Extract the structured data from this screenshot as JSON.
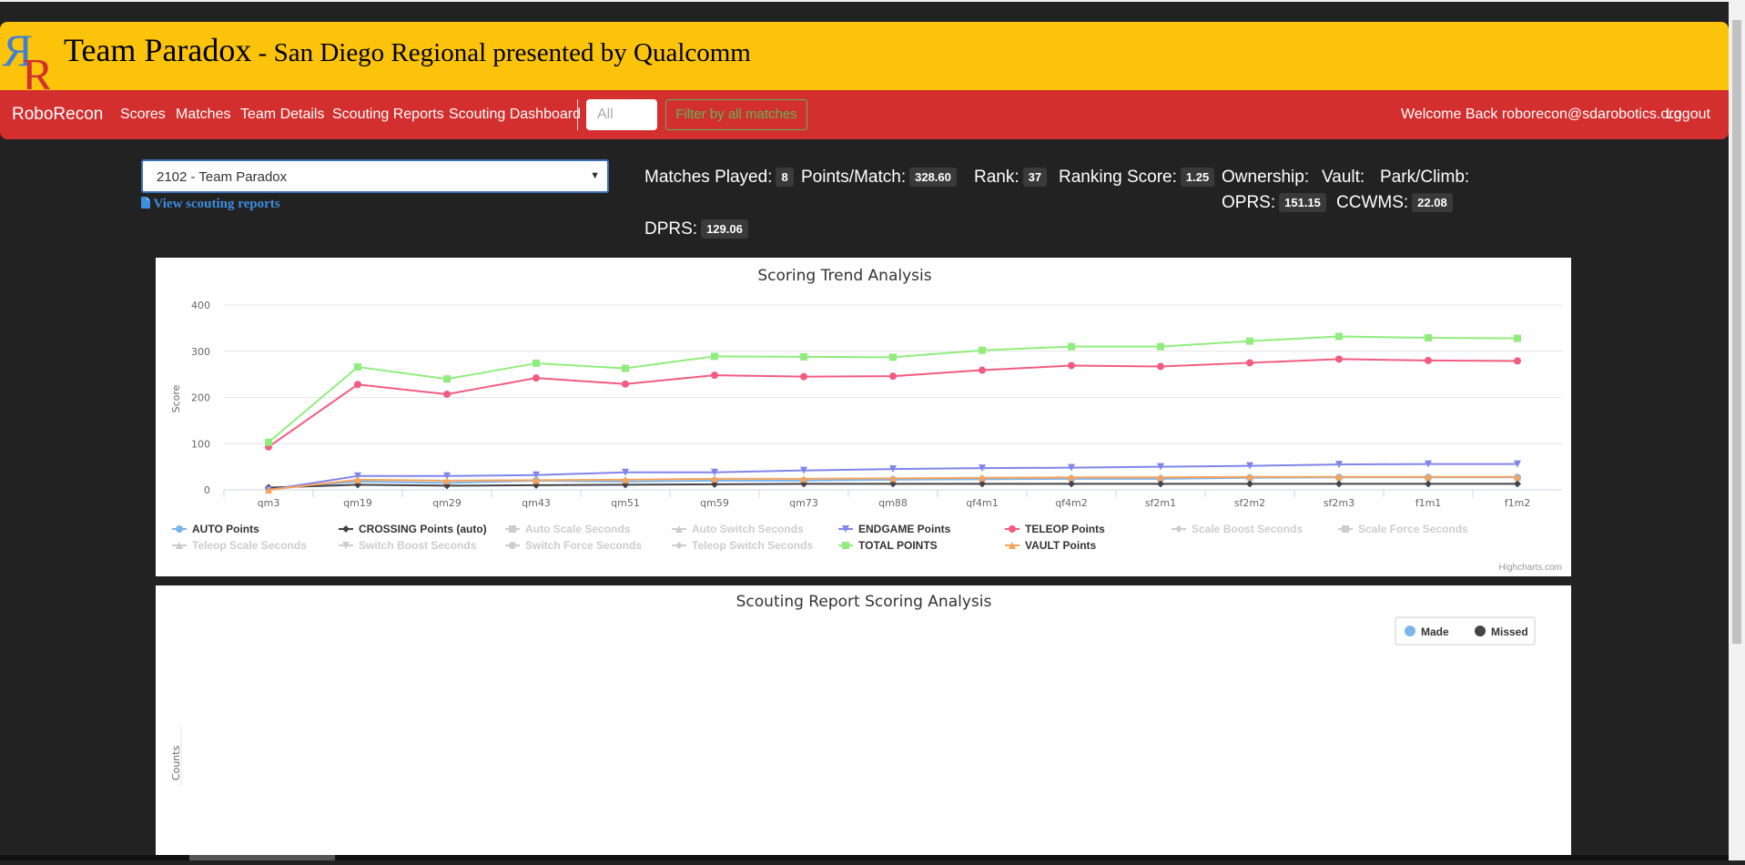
{
  "banner": {
    "team_name": "Team Paradox",
    "event_name": " - San Diego Regional presented by Qualcomm"
  },
  "nav": {
    "brand": "RoboRecon",
    "items": [
      "Scores",
      "Matches",
      "Team Details",
      "Scouting Reports",
      "Scouting Dashboard"
    ],
    "search_placeholder": "All",
    "filter_button": "Filter by all matches",
    "welcome": "Welcome Back roborecon@sdarobotics.org",
    "logout": "Logout"
  },
  "team_select": {
    "selected": "2102 - Team Paradox",
    "view_reports": "View scouting reports"
  },
  "stats": {
    "matches_played_label": "Matches Played:",
    "matches_played": "8",
    "points_per_match_label": "Points/Match:",
    "points_per_match": "328.60",
    "rank_label": "Rank:",
    "rank": "37",
    "ranking_score_label": "Ranking Score:",
    "ranking_score": "1.25",
    "ownership_label": "Ownership:",
    "vault_label": "Vault:",
    "park_climb_label": "Park/Climb:",
    "oprs_label": "OPRS:",
    "oprs": "151.15",
    "ccwms_label": "CCWMS:",
    "ccwms": "22.08",
    "dprs_label": "DPRS:",
    "dprs": "129.06"
  },
  "colors": {
    "banner": "#fcc30b",
    "navbar": "#d32f2f",
    "background": "#222222",
    "auto": "#7cb5ec",
    "crossing": "#434348",
    "endgame": "#8085e9",
    "teleop": "#f15c80",
    "total": "#90ed7d",
    "vault": "#f7a35c",
    "hidden": "#cccccc"
  },
  "chart_data": [
    {
      "type": "line",
      "title": "Scoring Trend Analysis",
      "ylabel": "Score",
      "ylim": [
        0,
        400
      ],
      "yticks": [
        0,
        100,
        200,
        300,
        400
      ],
      "grid": true,
      "legend_position": "bottom",
      "categories": [
        "qm3",
        "qm19",
        "qm29",
        "qm43",
        "qm51",
        "qm59",
        "qm73",
        "qm88",
        "qf4m1",
        "qf4m2",
        "sf2m1",
        "sf2m2",
        "sf2m3",
        "f1m1",
        "f1m2"
      ],
      "series": [
        {
          "name": "AUTO Points",
          "color": "#7cb5ec",
          "marker": "circle",
          "visible": true,
          "values": [
            3,
            18,
            15,
            20,
            18,
            20,
            20,
            22,
            23,
            24,
            24,
            26,
            27,
            27,
            27
          ]
        },
        {
          "name": "CROSSING Points (auto)",
          "color": "#434348",
          "marker": "diamond",
          "visible": true,
          "values": [
            5,
            11,
            9,
            10,
            11,
            12,
            13,
            13,
            13,
            13,
            13,
            13,
            13,
            13,
            13
          ]
        },
        {
          "name": "Auto Scale Seconds",
          "color": "#cccccc",
          "marker": "square",
          "visible": false,
          "values": []
        },
        {
          "name": "Auto Switch Seconds",
          "color": "#cccccc",
          "marker": "triangle",
          "visible": false,
          "values": []
        },
        {
          "name": "ENDGAME Points",
          "color": "#8085e9",
          "marker": "triangle-down",
          "visible": true,
          "values": [
            0,
            30,
            30,
            32,
            38,
            38,
            42,
            45,
            47,
            48,
            50,
            52,
            55,
            56,
            56
          ]
        },
        {
          "name": "TELEOP Points",
          "color": "#f15c80",
          "marker": "circle",
          "visible": true,
          "values": [
            93,
            228,
            207,
            242,
            229,
            248,
            245,
            246,
            259,
            269,
            267,
            275,
            283,
            280,
            279
          ]
        },
        {
          "name": "Scale Boost Seconds",
          "color": "#cccccc",
          "marker": "diamond",
          "visible": false,
          "values": []
        },
        {
          "name": "Scale Force Seconds",
          "color": "#cccccc",
          "marker": "square",
          "visible": false,
          "values": []
        },
        {
          "name": "Teleop Scale Seconds",
          "color": "#cccccc",
          "marker": "triangle",
          "visible": false,
          "values": []
        },
        {
          "name": "Switch Boost Seconds",
          "color": "#cccccc",
          "marker": "triangle-down",
          "visible": false,
          "values": []
        },
        {
          "name": "Switch Force Seconds",
          "color": "#cccccc",
          "marker": "circle",
          "visible": false,
          "values": []
        },
        {
          "name": "Teleop Switch Seconds",
          "color": "#cccccc",
          "marker": "diamond",
          "visible": false,
          "values": []
        },
        {
          "name": "TOTAL POINTS",
          "color": "#90ed7d",
          "marker": "square",
          "visible": true,
          "values": [
            103,
            266,
            240,
            274,
            263,
            289,
            288,
            287,
            302,
            310,
            310,
            322,
            332,
            329,
            328
          ]
        },
        {
          "name": "VAULT Points",
          "color": "#f7a35c",
          "marker": "triangle",
          "visible": true,
          "values": [
            0,
            22,
            20,
            21,
            22,
            24,
            24,
            25,
            26,
            27,
            27,
            28,
            28,
            28,
            28
          ]
        }
      ],
      "credits": "Highcharts.com"
    },
    {
      "type": "bar",
      "title": "Scouting Report Scoring Analysis",
      "ylabel": "Counts",
      "legend_position": "top-right",
      "series": [
        {
          "name": "Made",
          "color": "#7cb5ec",
          "values": []
        },
        {
          "name": "Missed",
          "color": "#434348",
          "values": []
        }
      ]
    }
  ]
}
